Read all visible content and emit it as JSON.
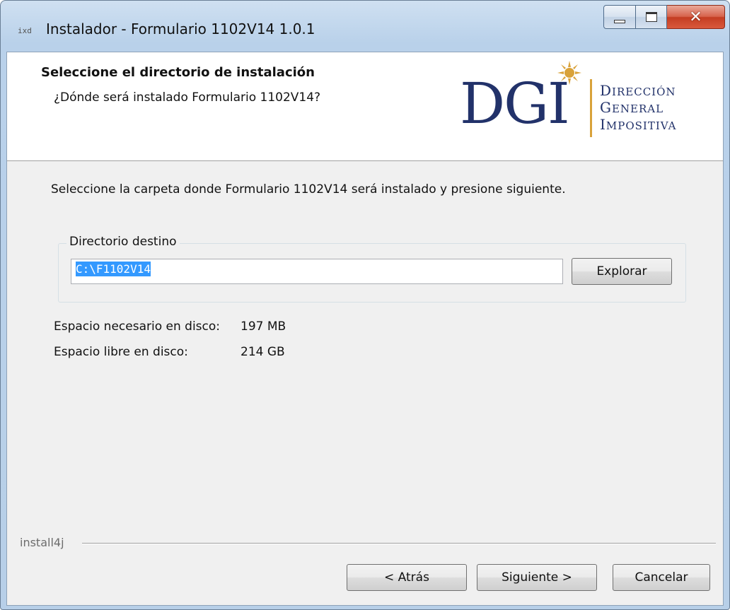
{
  "window": {
    "app_icon_text": "ixd",
    "title": "Instalador - Formulario 1102V14 1.0.1",
    "minimize_icon": "minimize-icon",
    "maximize_icon": "maximize-icon",
    "close_icon": "close-icon"
  },
  "header": {
    "title": "Seleccione el directorio de instalación",
    "subtitle": "¿Dónde será instalado Formulario 1102V14?",
    "logo": {
      "text": "DGI",
      "line1_cap": "D",
      "line1_rest": "IRECCIÓN",
      "line2_cap": "G",
      "line2_rest": "ENERAL",
      "line3_cap": "I",
      "line3_rest": "MPOSITIVA",
      "primary_color": "#22326a",
      "accent_color": "#d9a23a"
    }
  },
  "body": {
    "instruction": "Seleccione la carpeta donde Formulario 1102V14 será instalado y presione siguiente.",
    "group_label": "Directorio destino",
    "directory_value": "C:\\F1102V14",
    "explore_label": "Explorar",
    "space_required_label": "Espacio necesario en disco:",
    "space_required_value": "197 MB",
    "space_free_label": "Espacio libre en disco:",
    "space_free_value": "214 GB"
  },
  "footer": {
    "brand": "install4j",
    "back_label": "< Atrás",
    "next_label": "Siguiente >",
    "cancel_label": "Cancelar"
  }
}
